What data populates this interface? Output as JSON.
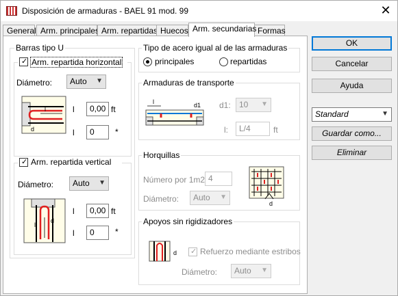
{
  "window": {
    "title": "Disposición de armaduras - BAEL 91 mod. 99",
    "close": "✕"
  },
  "tabs": [
    {
      "label": "General"
    },
    {
      "label": "Arm. principales"
    },
    {
      "label": "Arm. repartidas"
    },
    {
      "label": "Huecos"
    },
    {
      "label": "Arm. secundarias"
    },
    {
      "label": "Formas"
    }
  ],
  "barras_u": {
    "title": "Barras tipo U",
    "horizontal": {
      "label": "Arm. repartida horizontal",
      "checked": true,
      "diametro_label": "Diámetro:",
      "diametro_value": "Auto",
      "l_label": "l",
      "l_value": "0,00",
      "l_unit": "ft",
      "count_value": "0",
      "count_unit": "*",
      "pic_l": "l",
      "pic_d": "d"
    },
    "vertical": {
      "label": "Arm. repartida vertical",
      "checked": true,
      "diametro_label": "Diámetro:",
      "diametro_value": "Auto",
      "l_label": "l",
      "l_value": "0,00",
      "l_unit": "ft",
      "count_value": "0",
      "count_unit": "*",
      "pic_l": "l",
      "pic_d": "d"
    }
  },
  "tipo_acero": {
    "title": "Tipo de acero igual al de las armaduras",
    "options": [
      "principales",
      "repartidas"
    ],
    "selected": "principales"
  },
  "transporte": {
    "title": "Armaduras de transporte",
    "d1_label": "d1:",
    "d1_value": "10",
    "l_label": "l:",
    "l_value": "L/4",
    "l_unit": "ft",
    "pic_l": "l",
    "pic_d1": "d1"
  },
  "horquillas": {
    "title": "Horquillas",
    "numero_label": "Número por 1m2:",
    "numero_value": "4",
    "diametro_label": "Diámetro:",
    "diametro_value": "Auto",
    "pic_d": "d"
  },
  "apoyos": {
    "title": "Apoyos sin rigidizadores",
    "refuerzo_label": "Refuerzo mediante estribos",
    "refuerzo_checked": true,
    "diametro_label": "Diámetro:",
    "diametro_value": "Auto",
    "pic_d": "d"
  },
  "buttons": {
    "ok": "OK",
    "cancel": "Cancelar",
    "help": "Ayuda",
    "preset_value": "Standard",
    "save_as": "Guardar como...",
    "delete": "Eliminar"
  },
  "colors": {
    "accent": "#0078d7",
    "rebar_red": "#e02020",
    "concrete": "#fffde8"
  }
}
